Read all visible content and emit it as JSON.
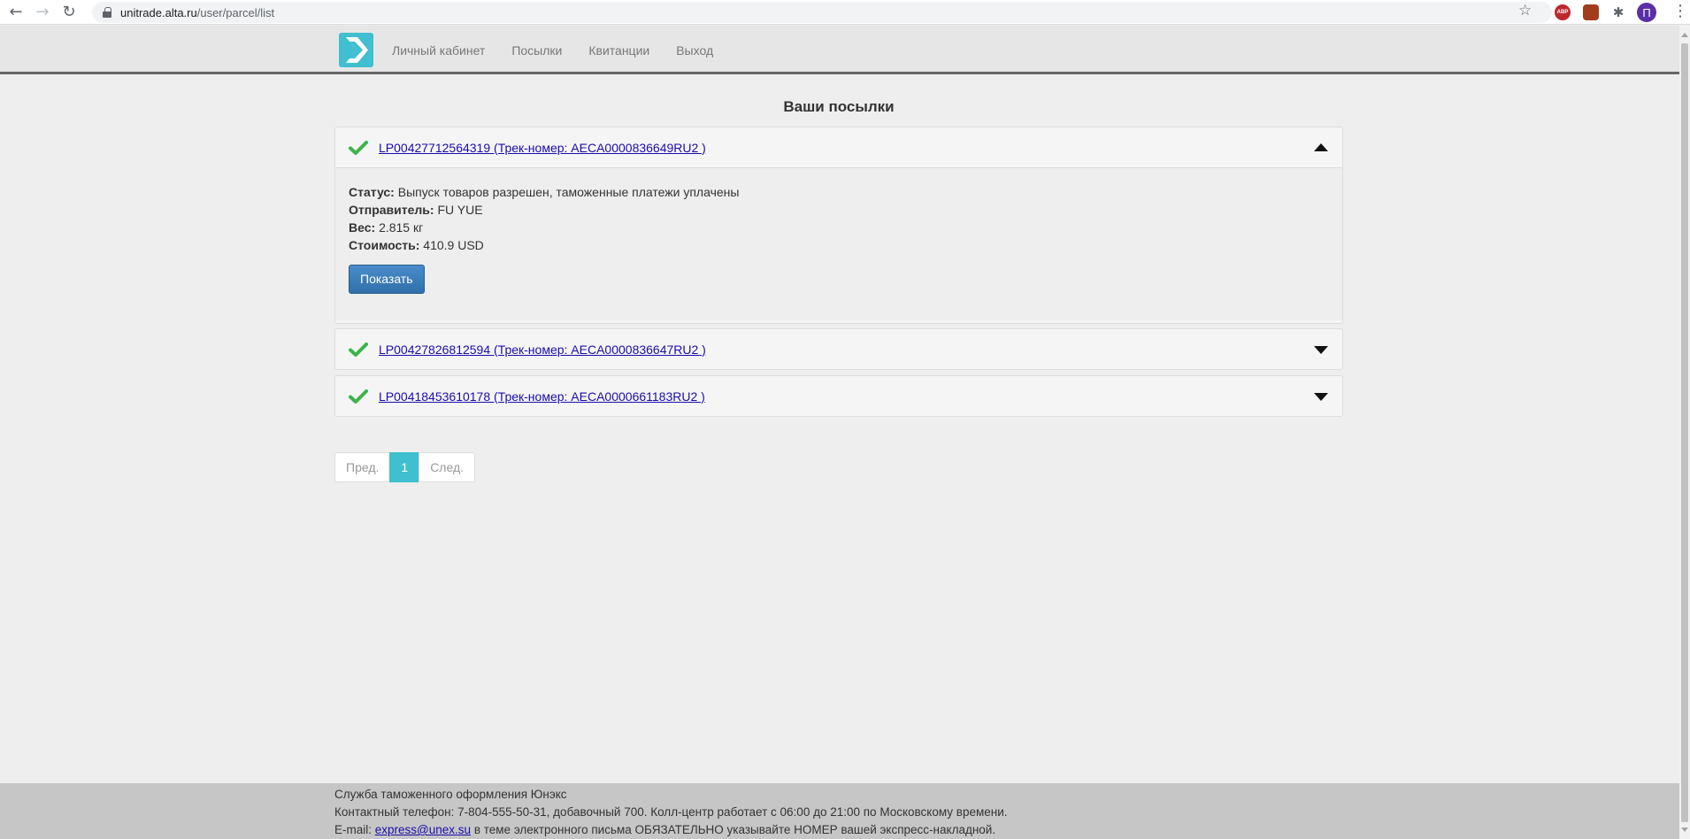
{
  "browser": {
    "back_icon": "back-arrow-icon",
    "forward_icon": "forward-arrow-icon",
    "reload_icon": "reload-icon",
    "url_domain": "unitrade.alta.ru",
    "url_path": "/user/parcel/list",
    "avatar_letter": "П",
    "abp_label": "ABP"
  },
  "header": {
    "nav": [
      "Личный кабинет",
      "Посылки",
      "Квитанции",
      "Выход"
    ]
  },
  "main": {
    "title": "Ваши посылки",
    "parcels": [
      {
        "link": "LP00427712564319 (Трек-номер: AECA0000836649RU2 )",
        "expanded": true,
        "status_label": "Статус:",
        "status": "Выпуск товаров разрешен, таможенные платежи уплачены",
        "sender_label": "Отправитель:",
        "sender": "FU YUE",
        "weight_label": "Вес:",
        "weight": "2.815 кг",
        "cost_label": "Стоимость:",
        "cost": "410.9 USD",
        "show_button": "Показать"
      },
      {
        "link": "LP00427826812594 (Трек-номер: AECA0000836647RU2 )",
        "expanded": false
      },
      {
        "link": "LP00418453610178 (Трек-номер: AECA0000661183RU2 )",
        "expanded": false
      }
    ]
  },
  "pagination": {
    "prev": "Пред.",
    "current": "1",
    "next": "След."
  },
  "footer": {
    "line1": "Служба таможенного оформления Юнэкс",
    "line2": "Контактный телефон: 7-804-555-50-31, добавочный 700. Колл-центр работает с 06:00 до 21:00 по Московскому времени.",
    "email_prefix": "E-mail:",
    "email": "express@unex.su",
    "line3_suffix": "в теме электронного письма ОБЯЗАТЕЛЬНО указывайте НОМЕР вашей экспресс-накладной."
  },
  "colors": {
    "accent": "#3fbfcf",
    "check": "#3cb44b",
    "link": "#1a0dab",
    "button": "#3071a9"
  }
}
